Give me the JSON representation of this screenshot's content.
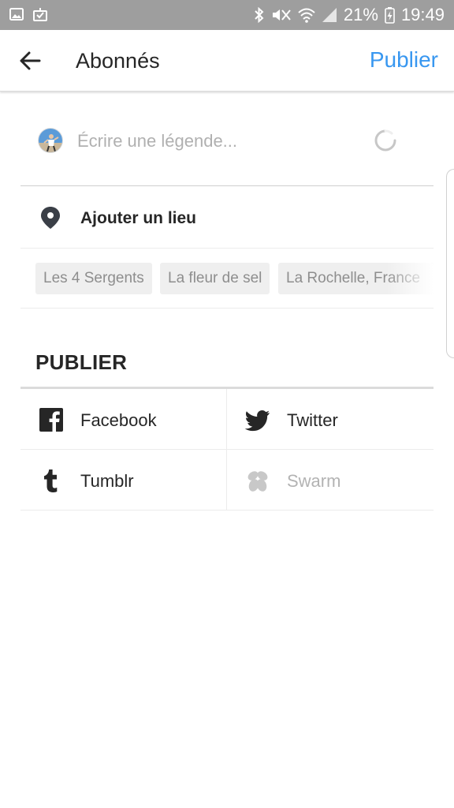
{
  "status_bar": {
    "left_icons": [
      "gallery-icon",
      "download-done-icon"
    ],
    "battery_percent": "21%",
    "time": "19:49",
    "right_icons": [
      "bluetooth-icon",
      "mute-vibrate-icon",
      "wifi-icon",
      "signal-icon",
      "battery-charging-icon"
    ]
  },
  "header": {
    "back_icon": "arrow-left-icon",
    "title": "Abonnés",
    "publish_label": "Publier",
    "accent_color": "#3897f0"
  },
  "caption": {
    "placeholder": "Écrire une légende...",
    "value": ""
  },
  "location": {
    "icon": "location-pin-icon",
    "label": "Ajouter un lieu",
    "suggestions": [
      "Les 4 Sergents",
      "La fleur de sel",
      "La Rochelle, France"
    ]
  },
  "share": {
    "heading": "PUBLIER",
    "targets": [
      {
        "label": "Facebook",
        "icon": "facebook-icon",
        "enabled": true
      },
      {
        "label": "Twitter",
        "icon": "twitter-icon",
        "enabled": true
      },
      {
        "label": "Tumblr",
        "icon": "tumblr-icon",
        "enabled": true
      },
      {
        "label": "Swarm",
        "icon": "swarm-icon",
        "enabled": false
      }
    ]
  }
}
